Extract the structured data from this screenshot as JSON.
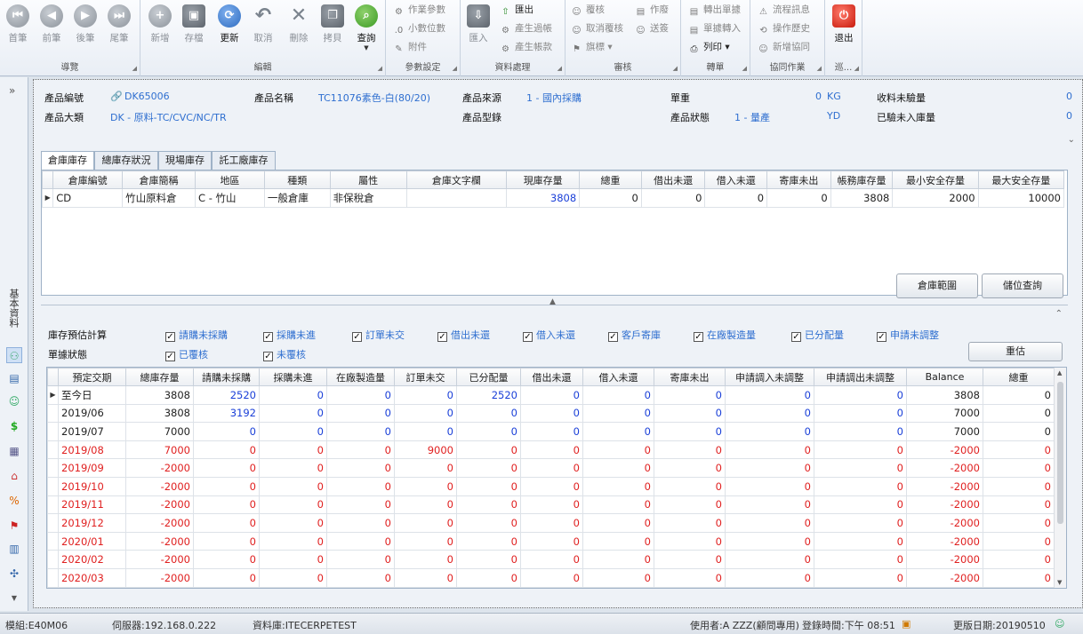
{
  "ribbon": {
    "groups": {
      "nav": "導覽",
      "edit": "編輯",
      "params": "參數設定",
      "data": "資料處理",
      "review": "審核",
      "transfer": "轉單",
      "collab": "協同作業",
      "patrol": "巡..."
    },
    "nav": [
      "首筆",
      "前筆",
      "後筆",
      "尾筆"
    ],
    "edit": [
      "新增",
      "存檔",
      "更新",
      "取消",
      "刪除",
      "拷貝",
      "查詢"
    ],
    "params": [
      "作業參數",
      "小數位數",
      "附件"
    ],
    "data": {
      "import": "匯入",
      "export": "匯出",
      "gen_entry": "產生過帳",
      "gen_account": "產生帳款"
    },
    "review": {
      "approve": "覆核",
      "cancel_approve": "取消覆核",
      "flag": "旗標",
      "void": "作廢",
      "send_sign": "送簽"
    },
    "transfer": {
      "out": "轉出單據",
      "in": "單據轉入",
      "print": "列印"
    },
    "collab": {
      "flow_msg": "流程訊息",
      "op_history": "操作歷史",
      "new_collab": "新增協同"
    },
    "exit": "退出"
  },
  "sidebar": {
    "title": "基本資料"
  },
  "info": {
    "product_no_label": "產品編號",
    "product_no": "DK65006",
    "product_name_label": "產品名稱",
    "product_name": "TC11076素色-白(80/20)",
    "source_label": "產品來源",
    "source": "1 - 國內採購",
    "unit_weight_label": "單重",
    "unit_weight": "0",
    "unit_weight_unit": "KG",
    "uninspected_label": "收料未驗量",
    "uninspected": "0",
    "category_label": "產品大類",
    "category": "DK - 原料-TC/CVC/NC/TR",
    "model_label": "產品型錄",
    "status_label": "產品狀態",
    "status": "1 - 量產",
    "status_unit": "YD",
    "pending_label": "已驗未入庫量",
    "pending": "0"
  },
  "tabs": [
    "倉庫庫存",
    "總庫存狀況",
    "現場庫存",
    "託工廠庫存"
  ],
  "warehouse": {
    "headers": [
      "倉庫編號",
      "倉庫簡稱",
      "地區",
      "種類",
      "屬性",
      "倉庫文字欄",
      "現庫存量",
      "總重",
      "借出未還",
      "借入未還",
      "寄庫未出",
      "帳務庫存量",
      "最小安全存量",
      "最大安全存量"
    ],
    "rows": [
      [
        "CD",
        "竹山原料倉",
        "C - 竹山",
        "一般倉庫",
        "非保稅倉",
        "",
        "3808",
        "0",
        "0",
        "0",
        "0",
        "3808",
        "2000",
        "10000"
      ]
    ]
  },
  "buttons": {
    "range": "倉庫範圍",
    "location": "儲位查詢",
    "recalc": "重估"
  },
  "estimate": {
    "label": "庫存預估計算",
    "options": [
      "請購未採購",
      "採購未進",
      "訂單未交",
      "借出未還",
      "借入未還",
      "客戶寄庫",
      "在廠製造量",
      "已分配量",
      "申請未調整"
    ],
    "doc_label": "單據狀態",
    "doc_options": [
      "已覆核",
      "未覆核"
    ]
  },
  "forecast": {
    "headers": [
      "預定交期",
      "總庫存量",
      "請購未採購",
      "採購未進",
      "在廠製造量",
      "訂單未交",
      "已分配量",
      "借出未還",
      "借入未還",
      "寄庫未出",
      "申請調入未調整",
      "申請調出未調整",
      "Balance",
      "總重"
    ],
    "rows": [
      [
        "至今日",
        "3808",
        "2520",
        "0",
        "0",
        "0",
        "2520",
        "0",
        "0",
        "0",
        "0",
        "0",
        "3808",
        "0"
      ],
      [
        "2019/06",
        "3808",
        "3192",
        "0",
        "0",
        "0",
        "0",
        "0",
        "0",
        "0",
        "0",
        "0",
        "7000",
        "0"
      ],
      [
        "2019/07",
        "7000",
        "0",
        "0",
        "0",
        "0",
        "0",
        "0",
        "0",
        "0",
        "0",
        "0",
        "7000",
        "0"
      ],
      [
        "2019/08",
        "7000",
        "0",
        "0",
        "0",
        "9000",
        "0",
        "0",
        "0",
        "0",
        "0",
        "0",
        "-2000",
        "0"
      ],
      [
        "2019/09",
        "-2000",
        "0",
        "0",
        "0",
        "0",
        "0",
        "0",
        "0",
        "0",
        "0",
        "0",
        "-2000",
        "0"
      ],
      [
        "2019/10",
        "-2000",
        "0",
        "0",
        "0",
        "0",
        "0",
        "0",
        "0",
        "0",
        "0",
        "0",
        "-2000",
        "0"
      ],
      [
        "2019/11",
        "-2000",
        "0",
        "0",
        "0",
        "0",
        "0",
        "0",
        "0",
        "0",
        "0",
        "0",
        "-2000",
        "0"
      ],
      [
        "2019/12",
        "-2000",
        "0",
        "0",
        "0",
        "0",
        "0",
        "0",
        "0",
        "0",
        "0",
        "0",
        "-2000",
        "0"
      ],
      [
        "2020/01",
        "-2000",
        "0",
        "0",
        "0",
        "0",
        "0",
        "0",
        "0",
        "0",
        "0",
        "0",
        "-2000",
        "0"
      ],
      [
        "2020/02",
        "-2000",
        "0",
        "0",
        "0",
        "0",
        "0",
        "0",
        "0",
        "0",
        "0",
        "0",
        "-2000",
        "0"
      ],
      [
        "2020/03",
        "-2000",
        "0",
        "0",
        "0",
        "0",
        "0",
        "0",
        "0",
        "0",
        "0",
        "0",
        "-2000",
        "0"
      ]
    ]
  },
  "status": {
    "module": "模組:E40M06",
    "server": "伺服器:192.168.0.222",
    "database": "資料庫:ITECERPETEST",
    "user": "使用者:A ZZZ(顧問專用)",
    "login": "登錄時間:下午 08:51",
    "version": "更版日期:20190510"
  }
}
